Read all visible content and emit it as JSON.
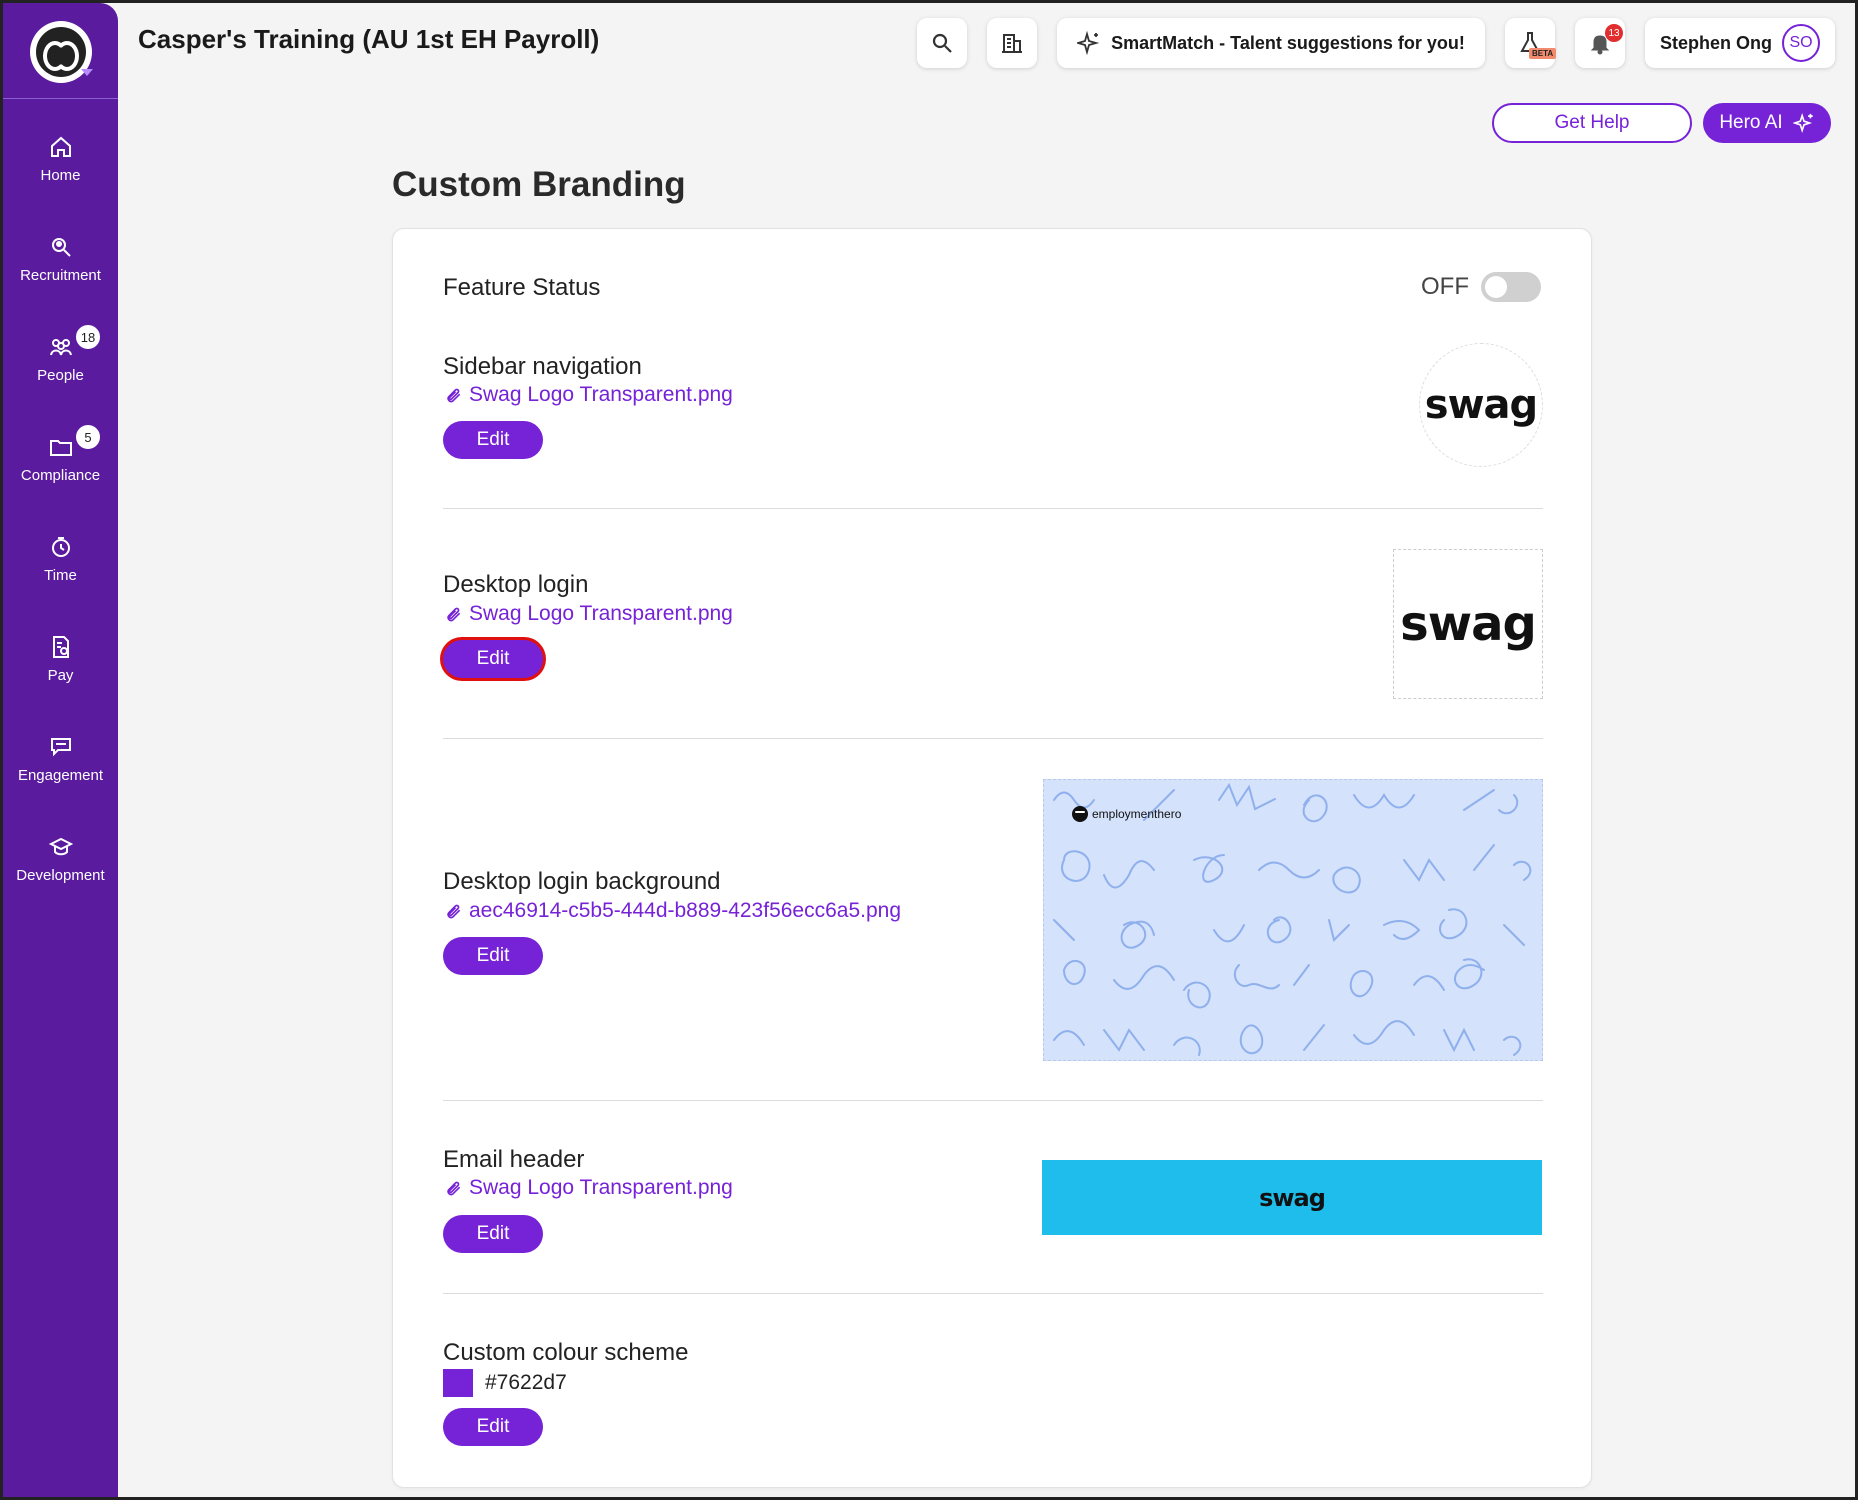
{
  "app": {
    "title": "Casper's Training (AU 1st EH Payroll)"
  },
  "sidebar": {
    "items": [
      {
        "label": "Home",
        "icon": "home-icon"
      },
      {
        "label": "Recruitment",
        "icon": "recruitment-icon"
      },
      {
        "label": "People",
        "icon": "people-icon",
        "badge": "18"
      },
      {
        "label": "Compliance",
        "icon": "folder-icon",
        "badge": "5"
      },
      {
        "label": "Time",
        "icon": "time-icon"
      },
      {
        "label": "Pay",
        "icon": "pay-icon"
      },
      {
        "label": "Engagement",
        "icon": "engagement-icon"
      },
      {
        "label": "Development",
        "icon": "development-icon"
      }
    ]
  },
  "header": {
    "smartmatch_label": "SmartMatch - Talent suggestions for you!",
    "beta_label": "BETA",
    "notifications_count": "13",
    "user_name": "Stephen Ong",
    "user_initials": "SO",
    "get_help_label": "Get Help",
    "hero_ai_label": "Hero AI"
  },
  "page": {
    "title": "Custom Branding"
  },
  "branding": {
    "feature_status_label": "Feature Status",
    "feature_status_value": "OFF",
    "sections": [
      {
        "title": "Sidebar navigation",
        "file": "Swag Logo Transparent.png",
        "edit_label": "Edit",
        "preview_text": "swag"
      },
      {
        "title": "Desktop login",
        "file": "Swag Logo Transparent.png",
        "edit_label": "Edit",
        "preview_text": "swag"
      },
      {
        "title": "Desktop login background",
        "file": "aec46914-c5b5-444d-b889-423f56ecc6a5.png",
        "edit_label": "Edit",
        "preview_brand": "employmenthero"
      },
      {
        "title": "Email header",
        "file": "Swag Logo Transparent.png",
        "edit_label": "Edit",
        "preview_text": "swag"
      },
      {
        "title": "Custom colour scheme",
        "color_value": "#7622d7",
        "edit_label": "Edit"
      }
    ]
  },
  "colors": {
    "brand_purple": "#7622d7",
    "sidebar_bg": "#5a1b9e",
    "email_header_bg": "#1fbdec",
    "login_bg_preview": "#d4e2fb"
  }
}
